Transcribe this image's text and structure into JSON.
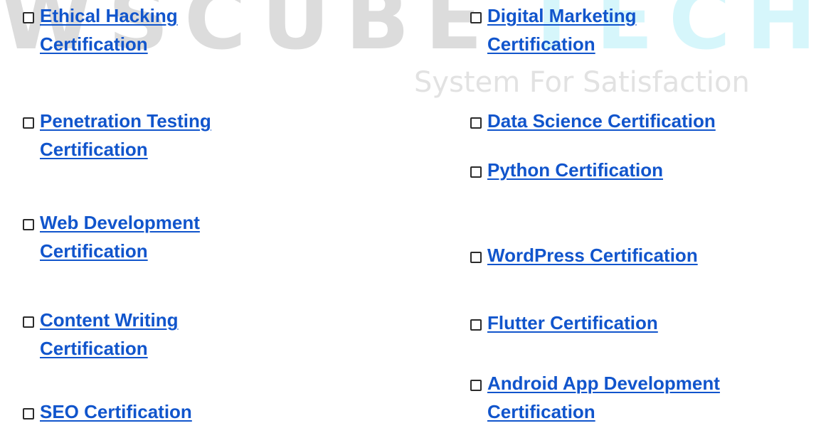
{
  "watermark": {
    "left_text": "WSCUBE",
    "right_text": "TECH",
    "tagline": "System For Satisfaction"
  },
  "left_column": [
    {
      "line1": "Ethical Hacking",
      "line2": "Certification",
      "checked": false
    },
    {
      "line1": "Penetration Testing",
      "line2": "Certification",
      "checked": false
    },
    {
      "line1": "Web Development",
      "line2": "Certification",
      "checked": false
    },
    {
      "line1": "Content Writing",
      "line2": "Certification",
      "checked": false
    },
    {
      "line1": "SEO Certification",
      "line2": "",
      "checked": false
    }
  ],
  "right_column": [
    {
      "line1": "Digital Marketing",
      "line2": "Certification",
      "checked": false
    },
    {
      "line1": "Data Science Certification",
      "line2": "",
      "checked": false
    },
    {
      "line1": "Python Certification",
      "line2": "",
      "checked": false
    },
    {
      "line1": "WordPress Certification",
      "line2": "",
      "checked": false
    },
    {
      "line1": "Flutter Certification",
      "line2": "",
      "checked": false
    },
    {
      "line1": "Android App Development",
      "line2": "Certification",
      "checked": false
    }
  ],
  "colors": {
    "link": "#1155cc",
    "checkbox_border": "#2b2b2b",
    "watermark_gray": "#dcdcdc",
    "watermark_cyan": "#d6f6fb"
  }
}
